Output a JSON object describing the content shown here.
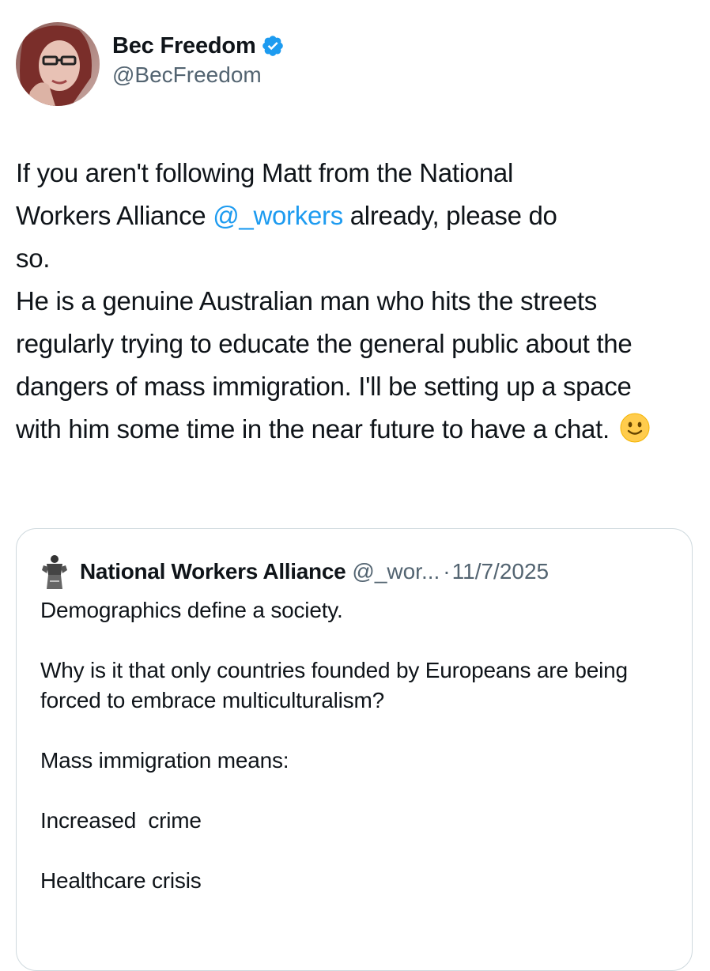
{
  "author": {
    "display_name": "Bec Freedom",
    "handle": "@BecFreedom",
    "verified_icon": "verified-badge-icon",
    "verified_color": "#1d9bf0"
  },
  "tweet": {
    "line1": "If you aren't following Matt from the National",
    "line2_prefix": "Workers Alliance ",
    "mention": "@_workers",
    "line2_suffix": " already, please do",
    "line3": "so.",
    "para2": "He is a genuine Australian man who hits the streets regularly trying to educate the general public about the dangers of mass immigration. I'll be setting up a space with him some time in the near future to have a chat.",
    "emoji": "slightly-smiling-face-icon",
    "mention_color": "#1d9bf0"
  },
  "quote": {
    "name": "National Workers Alliance",
    "handle": "@_wor...",
    "separator": "·",
    "date": "11/7/2025",
    "paragraphs": [
      "Demographics define a society.",
      "Why is it that only countries founded by Europeans are being forced to embrace multiculturalism?",
      "Mass immigration means:",
      "Increased  crime",
      "Healthcare crisis"
    ]
  }
}
